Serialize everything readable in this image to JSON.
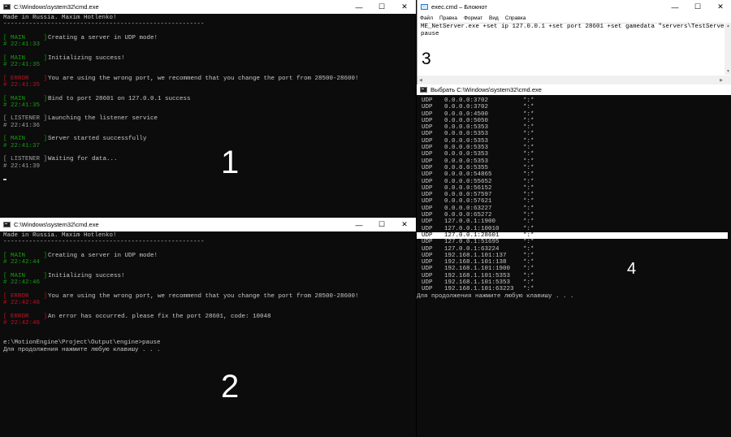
{
  "win1": {
    "title": "C:\\Windows\\system32\\cmd.exe",
    "header": "Made in Russia. Maxim Hotlenko!",
    "separator": "-------------------------------------------------------",
    "entries": [
      {
        "tag": "[ MAIN     ]",
        "ts": "# 22:41:33",
        "msg": "Creating a server in UDP mode!",
        "kind": "main"
      },
      {
        "tag": "[ MAIN     ]",
        "ts": "# 22:41:35",
        "msg": "Initializing success!",
        "kind": "main"
      },
      {
        "tag": "[ ERROR    ]",
        "ts": "# 22:41:35",
        "msg": "You are using the wrong port, we recommend that you change the port from 28500-28600!",
        "kind": "err"
      },
      {
        "tag": "[ MAIN     ]",
        "ts": "# 22:41:35",
        "msg": "Bind to port 28601 on 127.0.0.1 success",
        "kind": "main"
      },
      {
        "tag": "[ LISTENER ]",
        "ts": "# 22:41:36",
        "msg": "Launching the listener service",
        "kind": "lis"
      },
      {
        "tag": "[ MAIN     ]",
        "ts": "# 22:41:37",
        "msg": "Server started successfully",
        "kind": "main"
      },
      {
        "tag": "[ LISTENER ]",
        "ts": "# 22:41:39",
        "msg": "Waiting for data...",
        "kind": "lis"
      }
    ],
    "label": "1"
  },
  "win2": {
    "title": "C:\\Windows\\system32\\cmd.exe",
    "header": "Made in Russia. Maxim Hotlenko!",
    "separator": "-------------------------------------------------------",
    "entries": [
      {
        "tag": "[ MAIN     ]",
        "ts": "# 22:42:44",
        "msg": "Creating a server in UDP mode!",
        "kind": "main"
      },
      {
        "tag": "[ MAIN     ]",
        "ts": "# 22:42:46",
        "msg": "Initializing success!",
        "kind": "main"
      },
      {
        "tag": "[ ERROR    ]",
        "ts": "# 22:42:46",
        "msg": "You are using the wrong port, we recommend that you change the port from 28500-28600!",
        "kind": "err"
      },
      {
        "tag": "[ ERROR    ]",
        "ts": "# 22:42:46",
        "msg": "An error has occurred. please fix the port 28601, code: 10048",
        "kind": "err"
      }
    ],
    "prompt": "e:\\MotionEngine\\Project\\Output\\engine>pause",
    "press_key": "Для продолжения нажмите любую клавишу . . .",
    "label": "2"
  },
  "notepad": {
    "title": "exec.cmd – Блокнот",
    "menu": [
      "Файл",
      "Правка",
      "Формат",
      "Вид",
      "Справка"
    ],
    "lines": [
      "ME_NetServer.exe +set ip 127.0.0.1 +set port 28601 +set gamedata \"servers\\TestServer\"",
      "pause"
    ],
    "label": "3"
  },
  "win4": {
    "title": "Выбрать C:\\Windows\\system32\\cmd.exe",
    "rows": [
      [
        "UDP",
        "0.0.0.0:3702",
        "*:*"
      ],
      [
        "UDP",
        "0.0.0.0:3702",
        "*:*"
      ],
      [
        "UDP",
        "0.0.0.0:4500",
        "*:*"
      ],
      [
        "UDP",
        "0.0.0.0:5050",
        "*:*"
      ],
      [
        "UDP",
        "0.0.0.0:5353",
        "*:*"
      ],
      [
        "UDP",
        "0.0.0.0:5353",
        "*:*"
      ],
      [
        "UDP",
        "0.0.0.0:5353",
        "*:*"
      ],
      [
        "UDP",
        "0.0.0.0:5353",
        "*:*"
      ],
      [
        "UDP",
        "0.0.0.0:5353",
        "*:*"
      ],
      [
        "UDP",
        "0.0.0.0:5353",
        "*:*"
      ],
      [
        "UDP",
        "0.0.0.0:5355",
        "*:*"
      ],
      [
        "UDP",
        "0.0.0.0:54865",
        "*:*"
      ],
      [
        "UDP",
        "0.0.0.0:55652",
        "*:*"
      ],
      [
        "UDP",
        "0.0.0.0:56152",
        "*:*"
      ],
      [
        "UDP",
        "0.0.0.0:57597",
        "*:*"
      ],
      [
        "UDP",
        "0.0.0.0:57621",
        "*:*"
      ],
      [
        "UDP",
        "0.0.0.0:63227",
        "*:*"
      ],
      [
        "UDP",
        "0.0.0.0:65272",
        "*:*"
      ],
      [
        "UDP",
        "127.0.0.1:1900",
        "*:*"
      ],
      [
        "UDP",
        "127.0.0.1:10010",
        "*:*"
      ],
      [
        "UDP",
        "127.0.0.1:28601",
        "*:*"
      ],
      [
        "UDP",
        "127.0.0.1:51695",
        "*:*"
      ],
      [
        "UDP",
        "127.0.0.1:63224",
        "*:*"
      ],
      [
        "UDP",
        "192.168.1.101:137",
        "*:*"
      ],
      [
        "UDP",
        "192.168.1.101:138",
        "*:*"
      ],
      [
        "UDP",
        "192.168.1.101:1900",
        "*:*"
      ],
      [
        "UDP",
        "192.168.1.101:5353",
        "*:*"
      ],
      [
        "UDP",
        "192.168.1.101:5353",
        "*:*"
      ],
      [
        "UDP",
        "192.168.1.101:63223",
        "*:*"
      ]
    ],
    "highlighted_row": 20,
    "press_key": "Для продолжения нажмите любую клавишу . . .",
    "label": "4"
  }
}
